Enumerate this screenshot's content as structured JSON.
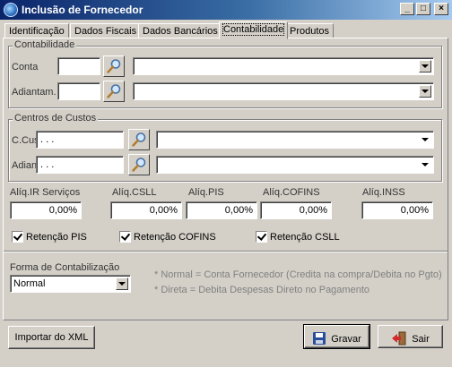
{
  "window": {
    "title": "Inclusão de Fornecedor"
  },
  "titlebar_buttons": {
    "minimize": "_",
    "maximize": "□",
    "close": "×"
  },
  "tabs": [
    {
      "label": "Identificação"
    },
    {
      "label": "Dados Fiscais"
    },
    {
      "label": "Dados Bancários"
    },
    {
      "label": "Contabilidade"
    },
    {
      "label": "Produtos"
    }
  ],
  "contabilidade": {
    "legend": "Contabilidade",
    "conta_label": "Conta",
    "conta_value": "",
    "adiantam_label": "Adiantam.",
    "adiantam_value": ""
  },
  "centros": {
    "legend": "Centros de Custos",
    "ccusto_label": "C.Custo",
    "ccusto_value": ". . .",
    "adiantam_label": "Adiantam.",
    "adiantam_value": ". . ."
  },
  "aliquotas": [
    {
      "label": "Alíq.IR Serviços",
      "value": "0,00%"
    },
    {
      "label": "Alíq.CSLL",
      "value": "0,00%"
    },
    {
      "label": "Alíq.PIS",
      "value": "0,00%"
    },
    {
      "label": "Alíq.COFINS",
      "value": "0,00%"
    },
    {
      "label": "Alíq.INSS",
      "value": "0,00%"
    }
  ],
  "retencoes": [
    {
      "label": "Retenção PIS",
      "checked": true
    },
    {
      "label": "Retenção COFINS",
      "checked": true
    },
    {
      "label": "Retenção CSLL",
      "checked": true
    }
  ],
  "forma": {
    "label": "Forma de Contabilização",
    "selected": "Normal",
    "note1": "* Normal = Conta Fornecedor (Credita na compra/Debita no Pgto)",
    "note2": "* Direta = Debita Despesas Direto no Pagamento"
  },
  "buttons": {
    "importar": "Importar do XML",
    "gravar": "Gravar",
    "sair": "Sair"
  },
  "icons": [
    "app-globe-icon",
    "magnifier-icon",
    "floppy-disk-icon",
    "exit-door-icon",
    "chevron-down-icon"
  ]
}
